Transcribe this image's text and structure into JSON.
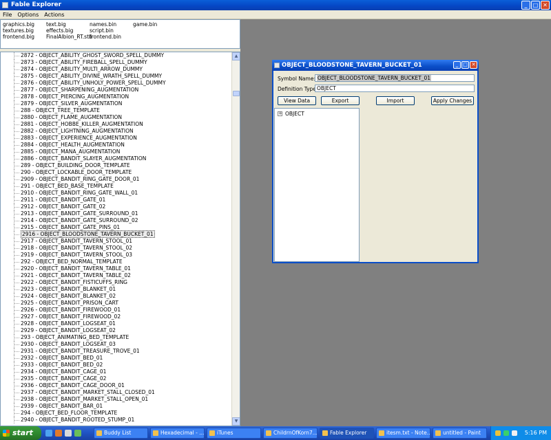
{
  "window": {
    "title": "Fable Explorer"
  },
  "menu": [
    "File",
    "Options",
    "Actions"
  ],
  "files": [
    "graphics.big",
    "text.big",
    "names.bin",
    "game.bin",
    "textures.big",
    "effects.big",
    "script.bin",
    "frontend.big",
    "FinalAlbion_RT.stb",
    "frontend.bin"
  ],
  "tree_items": [
    "2872 - OBJECT_ABILITY_GHOST_SWORD_SPELL_DUMMY",
    "2873 - OBJECT_ABILITY_FIREBALL_SPELL_DUMMY",
    "2874 - OBJECT_ABILITY_MULTI_ARROW_DUMMY",
    "2875 - OBJECT_ABILITY_DIVINE_WRATH_SPELL_DUMMY",
    "2876 - OBJECT_ABILITY_UNHOLY_POWER_SPELL_DUMMY",
    "2877 - OBJECT_SHARPENING_AUGMENTATION",
    "2878 - OBJECT_PIERCING_AUGMENTATION",
    "2879 - OBJECT_SILVER_AUGMENTATION",
    "288 - OBJECT_TREE_TEMPLATE",
    "2880 - OBJECT_FLAME_AUGMENTATION",
    "2881 - OBJECT_HOBBE_KILLER_AUGMENTATION",
    "2882 - OBJECT_LIGHTNING_AUGMENTATION",
    "2883 - OBJECT_EXPERIENCE_AUGMENTATION",
    "2884 - OBJECT_HEALTH_AUGMENTATION",
    "2885 - OBJECT_MANA_AUGMENTATION",
    "2886 - OBJECT_BANDIT_SLAYER_AUGMENTATION",
    "289 - OBJECT_BUILDING_DOOR_TEMPLATE",
    "290 - OBJECT_LOCKABLE_DOOR_TEMPLATE",
    "2909 - OBJECT_BANDIT_RING_GATE_DOOR_01",
    "291 - OBJECT_BED_BASE_TEMPLATE",
    "2910 - OBJECT_BANDIT_RING_GATE_WALL_01",
    "2911 - OBJECT_BANDIT_GATE_01",
    "2912 - OBJECT_BANDIT_GATE_02",
    "2913 - OBJECT_BANDIT_GATE_SURROUND_01",
    "2914 - OBJECT_BANDIT_GATE_SURROUND_02",
    "2915 - OBJECT_BANDIT_GATE_PINS_01",
    "2916 - OBJECT_BLOODSTONE_TAVERN_BUCKET_01",
    "2917 - OBJECT_BANDIT_TAVERN_STOOL_01",
    "2918 - OBJECT_BANDIT_TAVERN_STOOL_02",
    "2919 - OBJECT_BANDIT_TAVERN_STOOL_03",
    "292 - OBJECT_BED_NORMAL_TEMPLATE",
    "2920 - OBJECT_BANDIT_TAVERN_TABLE_01",
    "2921 - OBJECT_BANDIT_TAVERN_TABLE_02",
    "2922 - OBJECT_BANDIT_FISTICUFFS_RING",
    "2923 - OBJECT_BANDIT_BLANKET_01",
    "2924 - OBJECT_BANDIT_BLANKET_02",
    "2925 - OBJECT_BANDIT_PRISON_CART",
    "2926 - OBJECT_BANDIT_FIREWOOD_01",
    "2927 - OBJECT_BANDIT_FIREWOOD_02",
    "2928 - OBJECT_BANDIT_LOGSEAT_01",
    "2929 - OBJECT_BANDIT_LOGSEAT_02",
    "293 - OBJECT_ANIMATING_BED_TEMPLATE",
    "2930 - OBJECT_BANDIT_LOGSEAT_03",
    "2931 - OBJECT_BANDIT_TREASURE_TROVE_01",
    "2932 - OBJECT_BANDIT_BED_01",
    "2933 - OBJECT_BANDIT_BED_02",
    "2934 - OBJECT_BANDIT_CAGE_01",
    "2935 - OBJECT_BANDIT_CAGE_02",
    "2936 - OBJECT_BANDIT_CAGE_DOOR_01",
    "2937 - OBJECT_BANDIT_MARKET_STALL_CLOSED_01",
    "2938 - OBJECT_BANDIT_MARKET_STALL_OPEN_01",
    "2939 - OBJECT_BANDIT_BAR_01",
    "294 - OBJECT_BED_FLOOR_TEMPLATE",
    "2940 - OBJECT_BANDIT_ROOTED_STUMP_01"
  ],
  "selected_index": 26,
  "dialog": {
    "title": "OBJECT_BLOODSTONE_TAVERN_BUCKET_01",
    "symbol_label": "Symbol Name:",
    "symbol_value": "OBJECT_BLOODSTONE_TAVERN_BUCKET_01",
    "deftype_label": "Definition Type:",
    "deftype_value": "OBJECT",
    "buttons": {
      "view": "View Data",
      "export": "Export",
      "import": "Import",
      "apply": "Apply Changes"
    },
    "tree_root": "OBJECT",
    "expander": "+"
  },
  "taskbar": {
    "start": "start",
    "tasks": [
      "Buddy List",
      "Hexadecimal - ...",
      "iTunes",
      "ChildrnOfKorn7...",
      "Fable Explorer",
      "itesm.txt - Note...",
      "untitled - Paint"
    ],
    "active_index": 4,
    "clock": "5:16 PM"
  },
  "colors": {
    "titlebar": "#0a4ec8",
    "selection": "#ececec",
    "taskbar": "#2157c7",
    "start": "#2f8a2f"
  }
}
